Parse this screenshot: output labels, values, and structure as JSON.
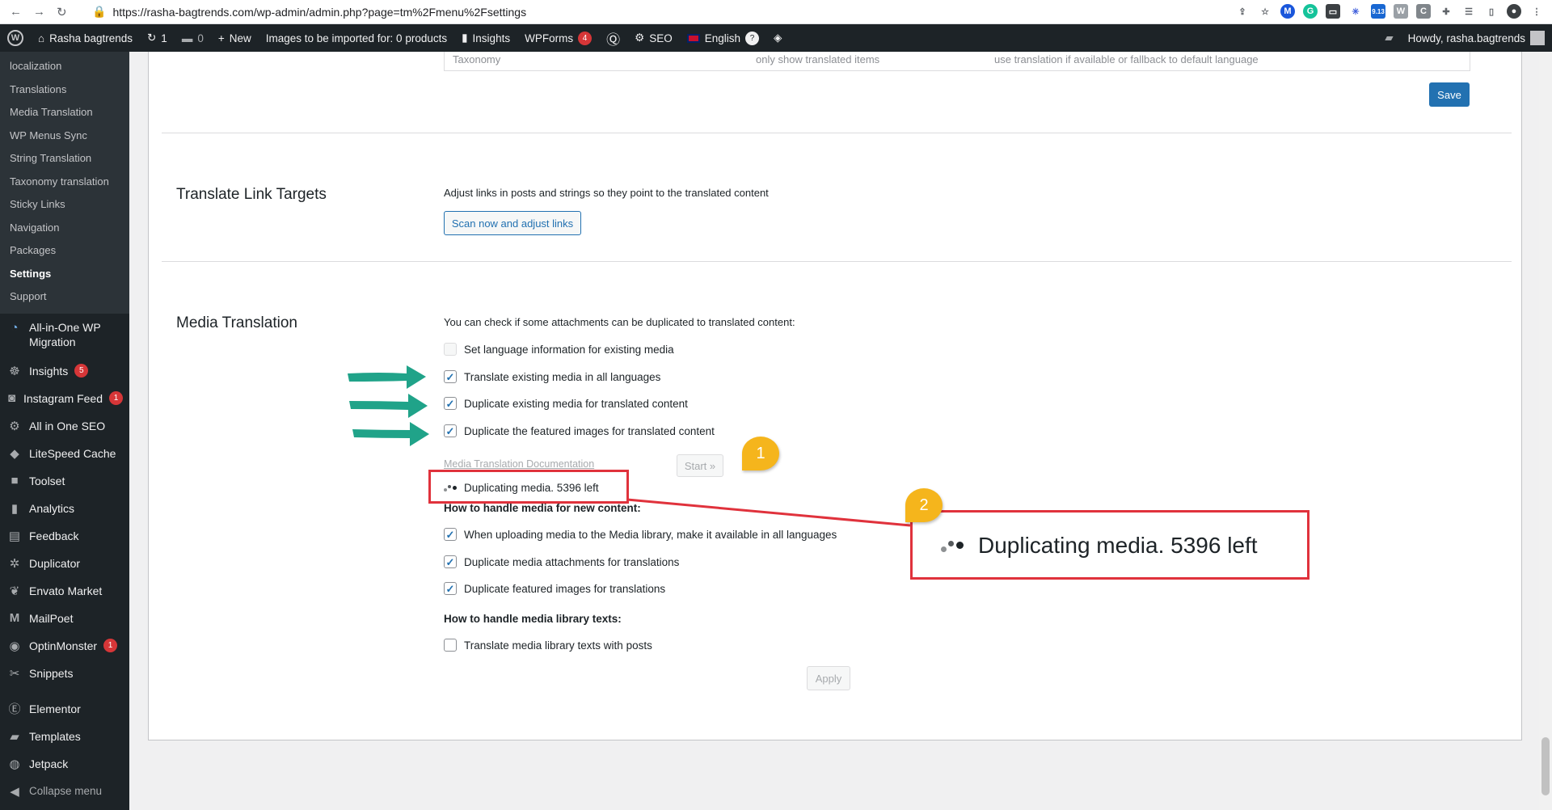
{
  "browser": {
    "url": "https://rasha-bagtrends.com/wp-admin/admin.php?page=tm%2Fmenu%2Fsettings",
    "ext_badge": "9.13"
  },
  "adminbar": {
    "site_name": "Rasha bagtrends",
    "updates_count": "1",
    "comments_count": "0",
    "new_label": "New",
    "images_import": "Images to be imported for: 0 products",
    "insights_label": "Insights",
    "wpforms_label": "WPForms",
    "wpforms_badge": "4",
    "seo_label": "SEO",
    "language_label": "English",
    "help_badge": "?",
    "howdy": "Howdy, rasha.bagtrends"
  },
  "sidebar": {
    "submenu": [
      {
        "label": "localization"
      },
      {
        "label": "Translations"
      },
      {
        "label": "Media Translation"
      },
      {
        "label": "WP Menus Sync"
      },
      {
        "label": "String Translation"
      },
      {
        "label": "Taxonomy translation"
      },
      {
        "label": "Sticky Links"
      },
      {
        "label": "Navigation"
      },
      {
        "label": "Packages"
      },
      {
        "label": "Settings"
      },
      {
        "label": "Support"
      }
    ],
    "menu": [
      {
        "label": "All-in-One WP Migration"
      },
      {
        "label": "Insights",
        "badge": "5"
      },
      {
        "label": "Instagram Feed",
        "badge": "1"
      },
      {
        "label": "All in One SEO"
      },
      {
        "label": "LiteSpeed Cache"
      },
      {
        "label": "Toolset"
      },
      {
        "label": "Analytics"
      },
      {
        "label": "Feedback"
      },
      {
        "label": "Duplicator"
      },
      {
        "label": "Envato Market"
      },
      {
        "label": "MailPoet"
      },
      {
        "label": "OptinMonster",
        "badge": "1"
      },
      {
        "label": "Snippets"
      },
      {
        "label": "Elementor"
      },
      {
        "label": "Templates"
      },
      {
        "label": "Jetpack"
      },
      {
        "label": "Collapse menu"
      }
    ]
  },
  "table_fragment": {
    "col1": "Taxonomy",
    "col2": "only show translated items",
    "col3": "use translation if available or fallback to default language"
  },
  "save_label": "Save",
  "link_targets": {
    "title": "Translate Link Targets",
    "description": "Adjust links in posts and strings so they point to the translated content",
    "button": "Scan now and adjust links"
  },
  "media_translation": {
    "title": "Media Translation",
    "intro": "You can check if some attachments can be duplicated to translated content:",
    "options": [
      {
        "label": "Set language information for existing media",
        "checked": false
      },
      {
        "label": "Translate existing media in all languages",
        "checked": true
      },
      {
        "label": "Duplicate existing media for translated content",
        "checked": true
      },
      {
        "label": "Duplicate the featured images for translated content",
        "checked": true
      }
    ],
    "doc_link": "Media Translation Documentation",
    "start_button": "Start »",
    "status": "Duplicating media. 5396 left",
    "new_content_heading": "How to handle media for new content:",
    "new_content_options": [
      {
        "label": "When uploading media to the Media library, make it available in all languages",
        "checked": true
      },
      {
        "label": "Duplicate media attachments for translations",
        "checked": true
      },
      {
        "label": "Duplicate featured images for translations",
        "checked": true
      }
    ],
    "library_heading": "How to handle media library texts:",
    "library_options": [
      {
        "label": "Translate media library texts with posts",
        "checked": false
      }
    ],
    "apply_button": "Apply"
  },
  "annotations": {
    "callout_1": "1",
    "callout_2": "2",
    "zoom_text": "Duplicating media. 5396 left",
    "arrow_color": "#20a389",
    "box_color": "#e0323c",
    "callout_color": "#f5b51c"
  },
  "colors": {
    "admin_dark": "#1d2327",
    "primary": "#2271b1",
    "badge_red": "#d63638"
  }
}
